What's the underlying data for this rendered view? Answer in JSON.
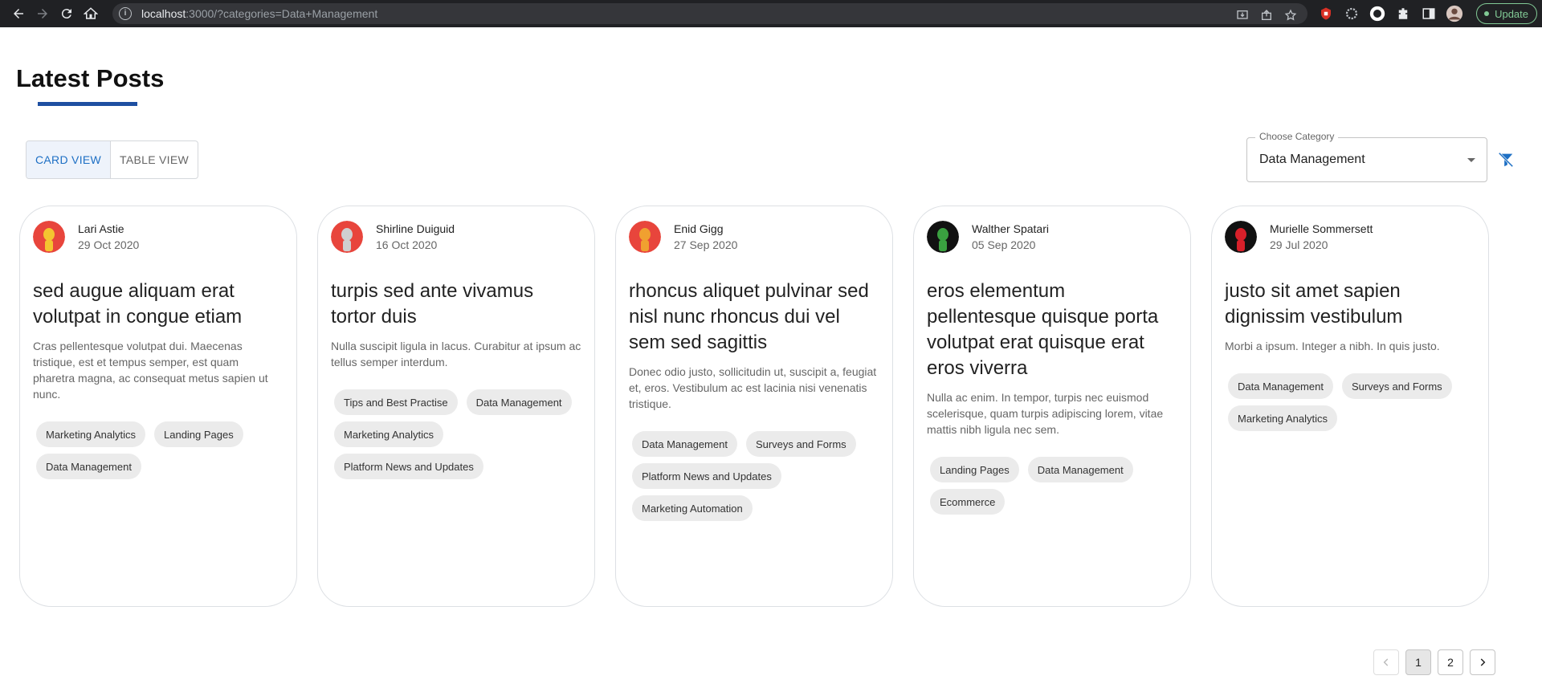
{
  "browser": {
    "url_host": "localhost",
    "url_path": ":3000/?categories=Data+Management",
    "update_label": "Update"
  },
  "page": {
    "title": "Latest Posts",
    "views": [
      "CARD VIEW",
      "TABLE VIEW"
    ],
    "active_view": "CARD VIEW",
    "category": {
      "label": "Choose Category",
      "value": "Data Management"
    }
  },
  "posts": [
    {
      "author": "Lari Astie",
      "date": "29 Oct 2020",
      "title": "sed augue aliquam erat volutpat in congue etiam",
      "body": "Cras pellentesque volutpat dui. Maecenas tristique, est et tempus semper, est quam pharetra magna, ac consequat metus sapien ut nunc.",
      "tags": [
        "Marketing Analytics",
        "Landing Pages",
        "Data Management"
      ],
      "avatar_color": "#e8453c",
      "avatar_figure": "#f4c430"
    },
    {
      "author": "Shirline Duiguid",
      "date": "16 Oct 2020",
      "title": "turpis sed ante vivamus tortor duis",
      "body": "Nulla suscipit ligula in lacus. Curabitur at ipsum ac tellus semper interdum.",
      "tags": [
        "Tips and Best Practise",
        "Data Management",
        "Marketing Analytics",
        "Platform News and Updates"
      ],
      "avatar_color": "#e8453c",
      "avatar_figure": "#cfcfcf"
    },
    {
      "author": "Enid Gigg",
      "date": "27 Sep 2020",
      "title": "rhoncus aliquet pulvinar sed nisl nunc rhoncus dui vel sem sed sagittis",
      "body": "Donec odio justo, sollicitudin ut, suscipit a, feugiat et, eros. Vestibulum ac est lacinia nisi venenatis tristique.",
      "tags": [
        "Data Management",
        "Surveys and Forms",
        "Platform News and Updates",
        "Marketing Automation"
      ],
      "avatar_color": "#e8453c",
      "avatar_figure": "#f0a030"
    },
    {
      "author": "Walther Spatari",
      "date": "05 Sep 2020",
      "title": "eros elementum pellentesque quisque porta volutpat erat quisque erat eros viverra",
      "body": "Nulla ac enim. In tempor, turpis nec euismod scelerisque, quam turpis adipiscing lorem, vitae mattis nibh ligula nec sem.",
      "tags": [
        "Landing Pages",
        "Data Management",
        "Ecommerce"
      ],
      "avatar_color": "#111111",
      "avatar_figure": "#3aa040"
    },
    {
      "author": "Murielle Sommersett",
      "date": "29 Jul 2020",
      "title": "justo sit amet sapien dignissim vestibulum",
      "body": "Morbi a ipsum. Integer a nibh. In quis justo.",
      "tags": [
        "Data Management",
        "Surveys and Forms",
        "Marketing Analytics"
      ],
      "avatar_color": "#111111",
      "avatar_figure": "#d8202a"
    }
  ],
  "pagination": {
    "pages": [
      "1",
      "2"
    ],
    "current": "1"
  },
  "colors": {
    "accent": "#1e4fa1",
    "active_view": "#1d6fc4"
  }
}
